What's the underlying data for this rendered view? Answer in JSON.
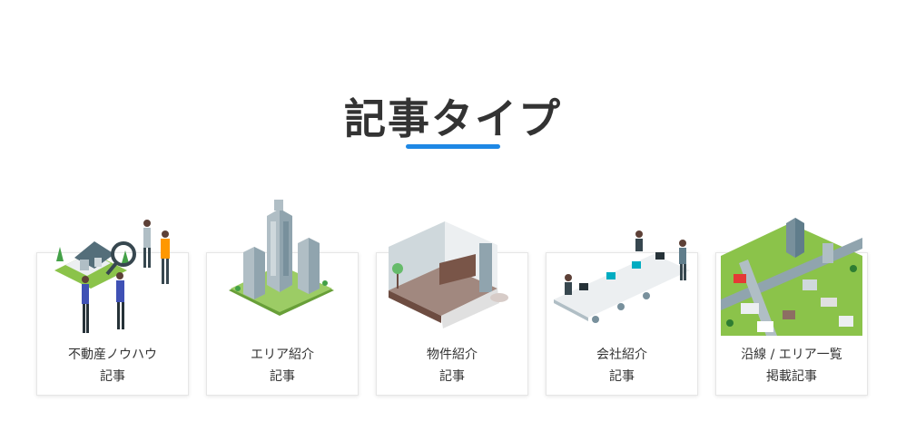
{
  "section": {
    "title": "記事タイプ",
    "accent_color": "#1e88e5"
  },
  "cards": [
    {
      "label": "不動産ノウハウ\n記事",
      "icon": "real-estate-knowhow-illustration"
    },
    {
      "label": "エリア紹介\n記事",
      "icon": "area-buildings-illustration"
    },
    {
      "label": "物件紹介\n記事",
      "icon": "room-interior-illustration"
    },
    {
      "label": "会社紹介\n記事",
      "icon": "office-illustration"
    },
    {
      "label": "沿線 / エリア一覧\n掲載記事",
      "icon": "city-map-illustration"
    }
  ]
}
